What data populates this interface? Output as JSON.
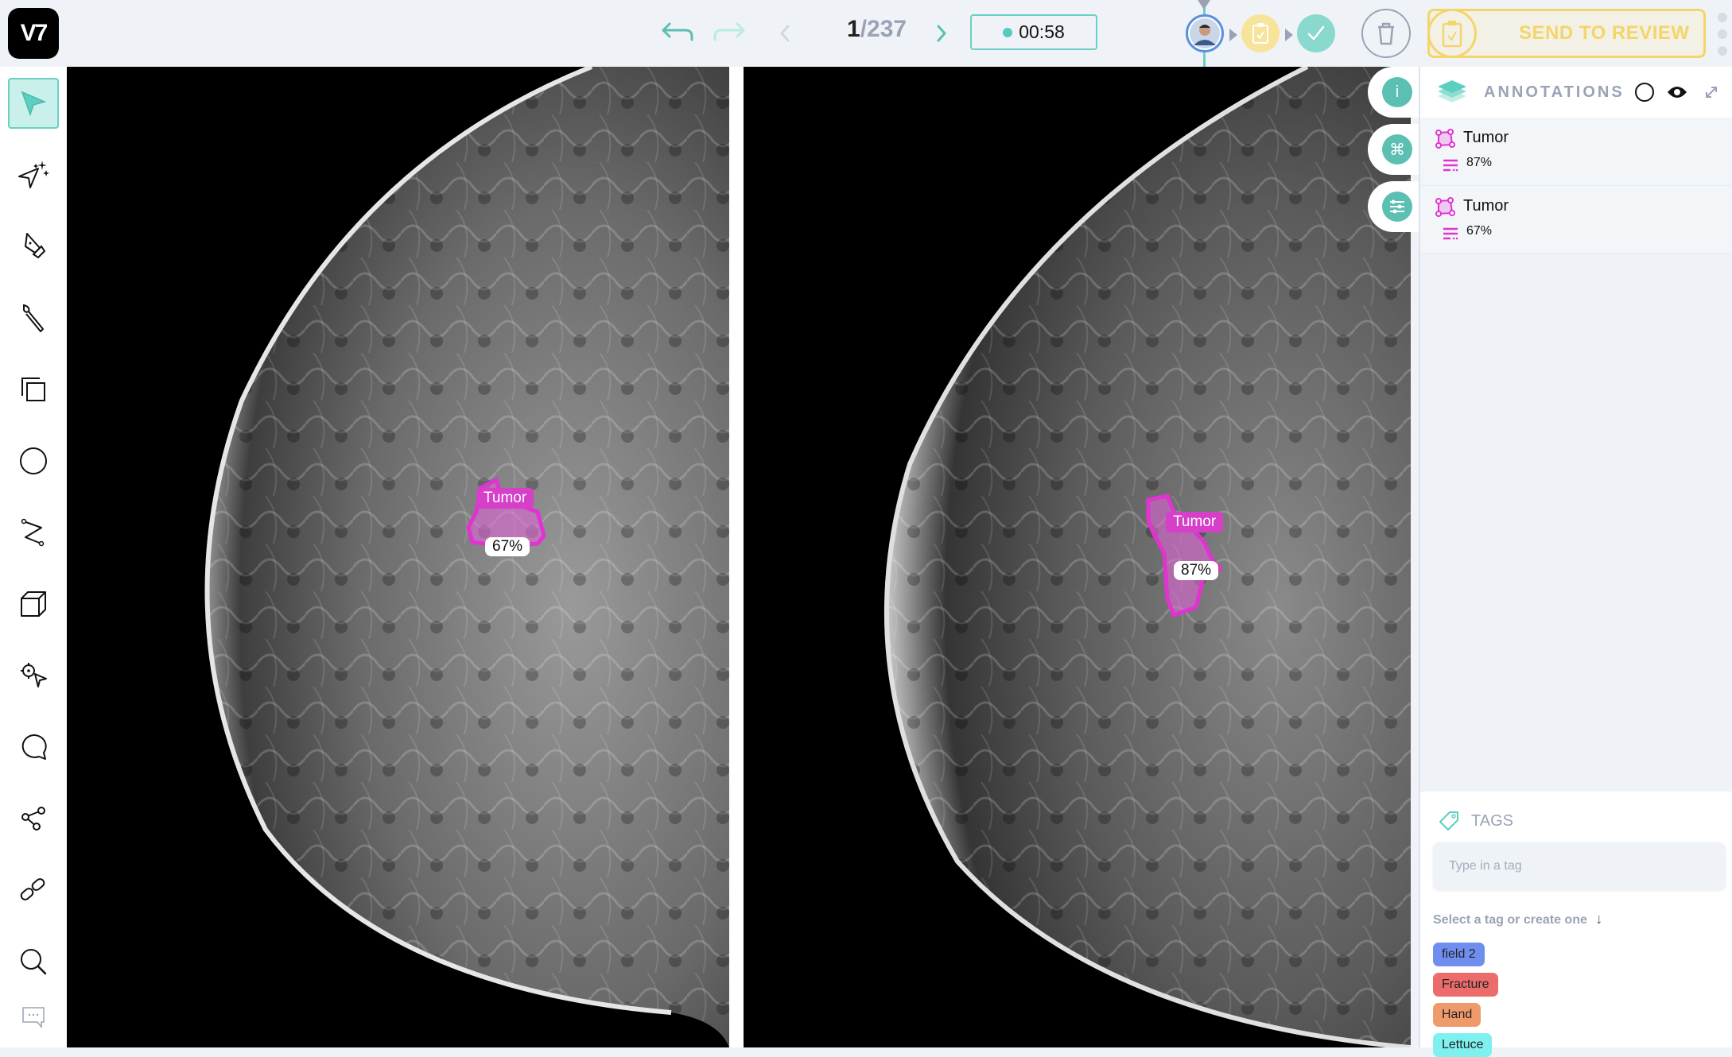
{
  "header": {
    "logo_text": "V7",
    "undo_icon": "undo-arrow-icon",
    "redo_icon": "redo-arrow-icon",
    "pager": {
      "current": "1",
      "separator": "/",
      "total": "237"
    },
    "timer": "00:58",
    "stages": [
      {
        "name": "annotate",
        "icon": "user-avatar",
        "color": "#5b8fe0"
      },
      {
        "name": "review",
        "icon": "clipboard-check-icon",
        "color": "#f4d56a"
      },
      {
        "name": "complete",
        "icon": "check-icon",
        "color": "#6bcfc3"
      }
    ],
    "send_to_review_label": "SEND TO REVIEW",
    "colors": {
      "accent": "#6bcfc3",
      "review": "#f4d56a",
      "muted": "#9aa3b5"
    }
  },
  "toolbar": {
    "tools": [
      {
        "name": "select",
        "icon": "cursor-arrow-icon",
        "active": true
      },
      {
        "name": "auto-annotate",
        "icon": "sparkle-cursor-icon"
      },
      {
        "name": "polygon",
        "icon": "pen-nib-icon"
      },
      {
        "name": "brush",
        "icon": "paint-brush-icon"
      },
      {
        "name": "bounding-box",
        "icon": "bounding-box-icon"
      },
      {
        "name": "ellipse",
        "icon": "ellipse-icon"
      },
      {
        "name": "polyline",
        "icon": "polyline-icon"
      },
      {
        "name": "cuboid",
        "icon": "cube-icon"
      },
      {
        "name": "keypoint",
        "icon": "keypoint-icon"
      },
      {
        "name": "comment",
        "icon": "speech-bubble-icon"
      },
      {
        "name": "skeleton",
        "icon": "skeleton-icon"
      },
      {
        "name": "link",
        "icon": "link-icon"
      },
      {
        "name": "zoom",
        "icon": "magnifier-icon"
      },
      {
        "name": "chat",
        "icon": "chat-dots-icon"
      }
    ]
  },
  "viewer": {
    "annotations": [
      {
        "label": "Tumor",
        "confidence": "67%",
        "color": "#d63fc8"
      },
      {
        "label": "Tumor",
        "confidence": "87%",
        "color": "#d63fc8"
      }
    ]
  },
  "side_tabs": [
    {
      "name": "info",
      "glyph": "i"
    },
    {
      "name": "shortcuts",
      "glyph": "⌘"
    },
    {
      "name": "settings",
      "glyph": "sliders"
    }
  ],
  "panel": {
    "title": "ANNOTATIONS",
    "items": [
      {
        "label": "Tumor",
        "confidence": "87%"
      },
      {
        "label": "Tumor",
        "confidence": "67%"
      }
    ],
    "tags": {
      "title": "TAGS",
      "input_placeholder": "Type in a tag",
      "hint": "Select a tag or create one",
      "chips": [
        {
          "label": "field 2",
          "color": "#6f8ef0"
        },
        {
          "label": "Fracture",
          "color": "#ec6b6b"
        },
        {
          "label": "Hand",
          "color": "#ef9a6b"
        },
        {
          "label": "Lettuce",
          "color": "#7ff0f0"
        }
      ]
    }
  }
}
